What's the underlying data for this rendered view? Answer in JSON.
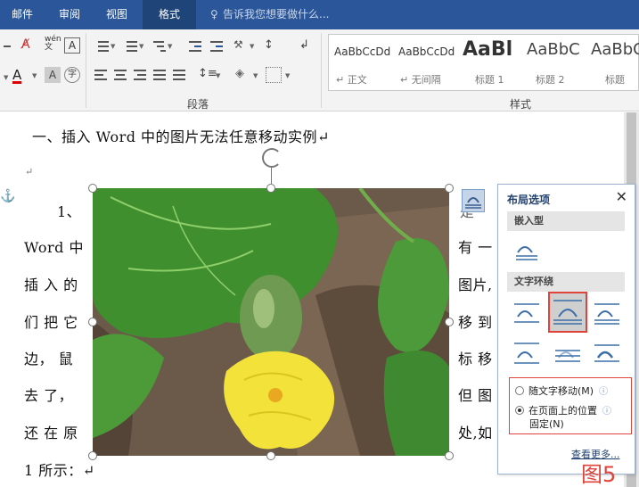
{
  "ribbon": {
    "tabs": [
      "邮件",
      "审阅",
      "视图",
      "格式"
    ],
    "active_tab": "格式",
    "tell_me": "告诉我您想要做什么...",
    "group_paragraph": "段落",
    "group_styles": "样式",
    "styles": [
      {
        "sample": "AaBbCcDd",
        "name": "↵ 正文"
      },
      {
        "sample": "AaBbCcDd",
        "name": "↵ 无间隔"
      },
      {
        "sample": "AaBl",
        "name": "标题 1"
      },
      {
        "sample": "AaBbC",
        "name": "标题 2"
      },
      {
        "sample": "AaBbC",
        "name": "标题"
      }
    ]
  },
  "document": {
    "heading": "一、插入 Word 中的图片无法任意移动实例↵",
    "empty_mark": "↵",
    "left_lines": [
      "1、",
      "Word 中",
      "插 入 的",
      "们 把 它",
      "边， 鼠",
      "去 了，",
      "还 在 原",
      "1 所示：↵"
    ],
    "right_lines": [
      "是",
      "有 一",
      "图片,",
      "移 到",
      "标 移",
      "但 图",
      "处,如"
    ]
  },
  "layout_panel": {
    "title": "布局选项",
    "close": "✕",
    "inline_section": "嵌入型",
    "wrap_section": "文字环绕",
    "option_move": "随文字移动(M)",
    "option_fixed_line1": "在页面上的位置",
    "option_fixed_line2": "固定(N)",
    "info_glyph": "ⓘ",
    "see_more": "查看更多...",
    "selected_wrap_index": 1
  },
  "figure_label": "图5",
  "colors": {
    "ribbon_blue": "#2b579a",
    "highlight_red": "#e0433a"
  }
}
